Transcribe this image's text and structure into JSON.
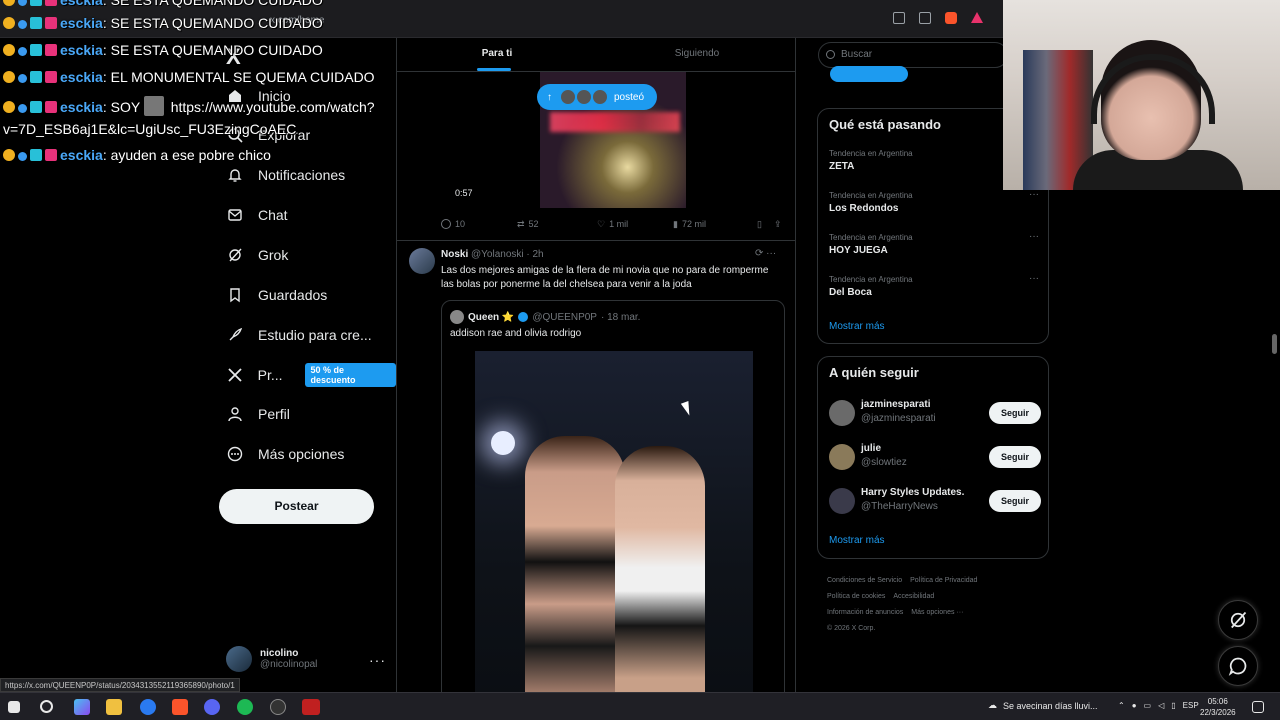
{
  "browser": {
    "address": "x.com/home"
  },
  "chat": {
    "lines": [
      {
        "user": "esckia",
        "text": ": SE ESTA QUEMANDO CUIDADO"
      },
      {
        "user": "esckia",
        "text": ": SE ESTA QUEMANDO CUIDADO"
      },
      {
        "user": "esckia",
        "text": ": SE ESTA QUEMANDO CUIDADO"
      },
      {
        "user": "esckia",
        "text": ": EL MONUMENTAL SE QUEMA CUIDADO"
      },
      {
        "user": "esckia",
        "text": ": SOY",
        "link": "https://www.youtube.com/watch?",
        "link2": "v=7D_ESB6aj1E&lc=UgiUsc_FU3EzingCoAEC"
      },
      {
        "user": "esckia",
        "text": ": ayuden a ese pobre chico"
      }
    ]
  },
  "nav": {
    "logo": "X",
    "items": [
      {
        "label": "Inicio",
        "icon": "home-icon"
      },
      {
        "label": "Explorar",
        "icon": "search-icon"
      },
      {
        "label": "Notificaciones",
        "icon": "bell-icon"
      },
      {
        "label": "Chat",
        "icon": "mail-icon"
      },
      {
        "label": "Grok",
        "icon": "grok-icon"
      },
      {
        "label": "Guardados",
        "icon": "bookmark-icon"
      },
      {
        "label": "Estudio para cre...",
        "icon": "rocket-icon"
      },
      {
        "label": "Pr...",
        "icon": "x-premium-icon"
      },
      {
        "label": "Perfil",
        "icon": "person-icon"
      },
      {
        "label": "Más opciones",
        "icon": "more-circle-icon"
      }
    ],
    "premium_badge": "50 % de descuento",
    "post_button": "Postear",
    "profile": {
      "name": "nicolino",
      "handle": "@nicolinopal"
    }
  },
  "tabs": [
    {
      "label": "Para ti",
      "active": true
    },
    {
      "label": "Siguiendo",
      "active": false
    }
  ],
  "feed": {
    "video": {
      "duration": "0:57",
      "posted_pill": "posteó"
    },
    "video_actions": {
      "replies": "10",
      "reposts": "52",
      "likes": "1 mil",
      "views": "72 mil"
    },
    "post2": {
      "name": "Noski",
      "handle": "@Yolanoski",
      "time": "· 2h",
      "text": "Las dos mejores amigas de la flera de mi novia que no para de romperme las bolas por ponerme la del chelsea para venir a la joda",
      "quote": {
        "name": "Queen ⭐",
        "handle": "@QUEENP0P",
        "date": "· 18 mar.",
        "text": "addison rae and olivia rodrigo"
      }
    }
  },
  "right": {
    "search_placeholder": "Buscar",
    "trends_title": "Qué está pasando",
    "trends": [
      {
        "label": "Tendencia en Argentina",
        "name": "ZETA"
      },
      {
        "label": "Tendencia en Argentina",
        "name": "Los Redondos"
      },
      {
        "label": "Tendencia en Argentina",
        "name": "HOY JUEGA"
      },
      {
        "label": "Tendencia en Argentina",
        "name": "Del Boca"
      }
    ],
    "show_more": "Mostrar más",
    "follow_title": "A quién seguir",
    "follow": [
      {
        "name": "jazminesparati",
        "handle": "@jazminesparati",
        "button": "Seguir"
      },
      {
        "name": "julie",
        "handle": "@slowtiez",
        "button": "Seguir"
      },
      {
        "name": "Harry Styles Updates.",
        "handle": "@TheHarryNews",
        "button": "Seguir"
      }
    ],
    "show_more2": "Mostrar más",
    "footer": {
      "l1": "Condiciones de Servicio",
      "l2": "Política de Privacidad",
      "l3": "Política de cookies",
      "l4": "Accesibilidad",
      "l5": "Información de anuncios",
      "l6": "Más opciones ···",
      "l7": "© 2026 X Corp."
    }
  },
  "status_url": "https://x.com/QUEENP0P/status/2034313552119365890/photo/1",
  "taskbar": {
    "weather": "Se avecinan días lluvi...",
    "lang": "ESP",
    "time": "05:06",
    "date": "22/3/2026"
  },
  "colors": {
    "accent": "#1d9bf0",
    "background": "#000000",
    "text": "#e7e9ea",
    "muted": "#71767b"
  }
}
